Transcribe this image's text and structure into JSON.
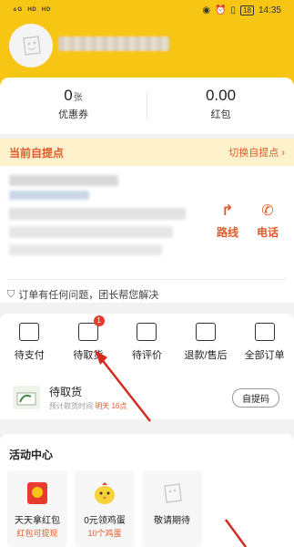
{
  "status_bar": {
    "signal": "⁴ᴳ  ᴴᴰ  ᴴᴰ",
    "battery": "18",
    "time": "14:35"
  },
  "summary": {
    "coupons": {
      "value": "0",
      "unit": "张",
      "label": "优惠券"
    },
    "redpacket": {
      "value": "0.00",
      "label": "红包"
    }
  },
  "pickup": {
    "title": "当前自提点",
    "switch_label": "切换自提点",
    "route_label": "路线",
    "phone_label": "电话",
    "notice": "订单有任何问题，团长帮您解决"
  },
  "orders": {
    "tabs": [
      {
        "label": "待支付",
        "icon": "wallet-icon"
      },
      {
        "label": "待取货",
        "icon": "box-icon",
        "badge": "1"
      },
      {
        "label": "待评价",
        "icon": "comment-icon"
      },
      {
        "label": "退款/售后",
        "icon": "refund-icon"
      },
      {
        "label": "全部订单",
        "icon": "list-icon"
      }
    ],
    "pending": {
      "title": "待取货",
      "sub_prefix": "预计取货时间",
      "sub_time": "明天 16点",
      "code_button": "自提码"
    }
  },
  "activity": {
    "title": "活动中心",
    "items": [
      {
        "name": "天天拿红包",
        "sub": "红包可提现",
        "icon": "redpacket-icon"
      },
      {
        "name": "0元领鸡蛋",
        "sub": "10个鸡蛋",
        "icon": "chick-icon"
      },
      {
        "name": "敬请期待",
        "sub": "",
        "icon": "placeholder-icon"
      }
    ]
  },
  "colors": {
    "brand_yellow": "#f7c514",
    "accent_orange": "#e05a2b",
    "badge_red": "#e63b2e"
  }
}
